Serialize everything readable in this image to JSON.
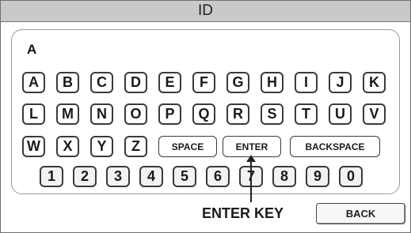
{
  "title": "ID",
  "entry_value": "A",
  "keyboard": {
    "row1": [
      "A",
      "B",
      "C",
      "D",
      "E",
      "F",
      "G",
      "H",
      "I",
      "J",
      "K"
    ],
    "row2": [
      "L",
      "M",
      "N",
      "O",
      "P",
      "Q",
      "R",
      "S",
      "T",
      "U",
      "V"
    ],
    "row3": [
      "W",
      "X",
      "Y",
      "Z",
      "SPACE",
      "ENTER",
      "BACKSPACE"
    ],
    "row4": [
      "1",
      "2",
      "3",
      "4",
      "5",
      "6",
      "7",
      "8",
      "9",
      "0"
    ]
  },
  "callout_label": "ENTER KEY",
  "back_label": "BACK"
}
